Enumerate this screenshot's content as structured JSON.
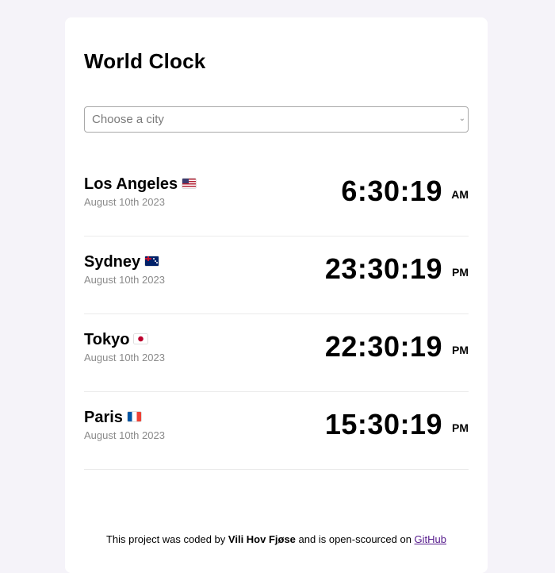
{
  "app": {
    "title": "World Clock"
  },
  "select": {
    "placeholder": "Choose a city"
  },
  "cities": [
    {
      "name": "Los Angeles",
      "flag": "us-flag-icon",
      "date": "August 10th 2023",
      "time": "6:30:19",
      "ampm": "AM"
    },
    {
      "name": "Sydney",
      "flag": "au-flag-icon",
      "date": "August 10th 2023",
      "time": "23:30:19",
      "ampm": "PM"
    },
    {
      "name": "Tokyo",
      "flag": "jp-flag-icon",
      "date": "August 10th 2023",
      "time": "22:30:19",
      "ampm": "PM"
    },
    {
      "name": "Paris",
      "flag": "fr-flag-icon",
      "date": "August 10th 2023",
      "time": "15:30:19",
      "ampm": "PM"
    }
  ],
  "footer": {
    "prefix": "This project was coded by",
    "author": "Vili Hov Fjøse",
    "middle": "and is open-scourced on",
    "link_text": "GitHub"
  },
  "colors": {
    "page_background": "#f5f3f9",
    "card_background": "#ffffff",
    "secondary_text": "#8a8a8a",
    "link": "#551a8b"
  }
}
